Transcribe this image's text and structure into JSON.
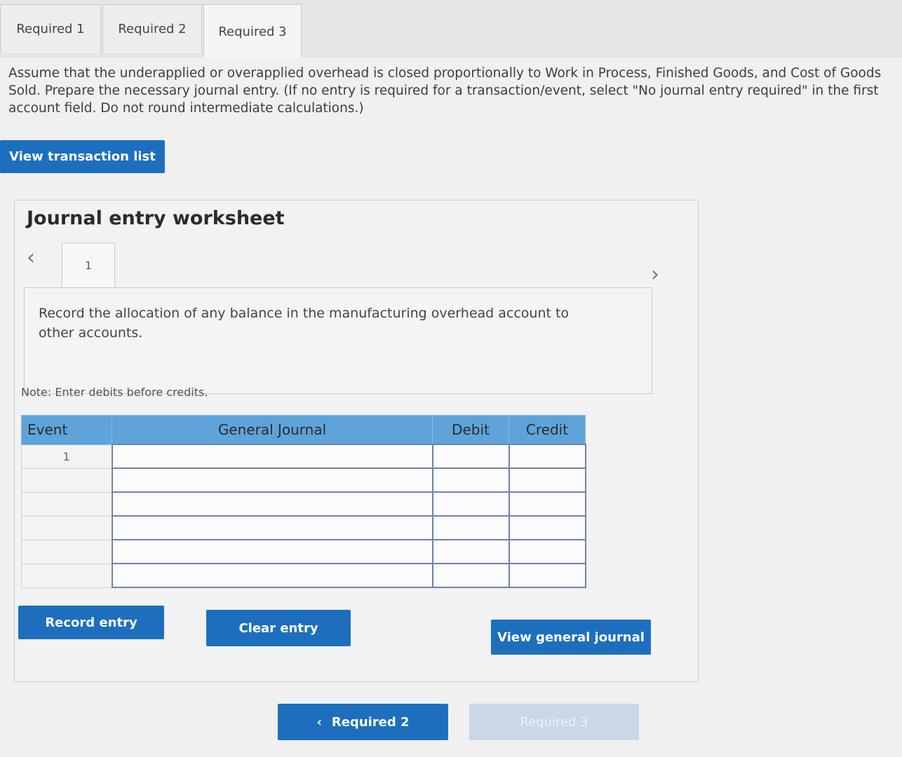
{
  "tabs": [
    {
      "label": "Required 1",
      "active": false
    },
    {
      "label": "Required 2",
      "active": false
    },
    {
      "label": "Required 3",
      "active": true
    }
  ],
  "instructions": "Assume that the underapplied or overapplied overhead is closed proportionally to Work in Process, Finished Goods, and Cost of Goods Sold. Prepare the necessary journal entry. (If no entry is required for a transaction/event, select \"No journal entry required\" in the first account field. Do not round intermediate calculations.)",
  "view_transaction_list": "View transaction list",
  "worksheet": {
    "title": "Journal entry worksheet",
    "entry_tab": "1",
    "description": "Record the allocation of any balance in the manufacturing overhead account to other accounts.",
    "note": "Note: Enter debits before credits.",
    "columns": [
      "Event",
      "General Journal",
      "Debit",
      "Credit"
    ],
    "rows": [
      {
        "event": "1",
        "account": "",
        "debit": "",
        "credit": ""
      },
      {
        "event": "",
        "account": "",
        "debit": "",
        "credit": ""
      },
      {
        "event": "",
        "account": "",
        "debit": "",
        "credit": ""
      },
      {
        "event": "",
        "account": "",
        "debit": "",
        "credit": ""
      },
      {
        "event": "",
        "account": "",
        "debit": "",
        "credit": ""
      },
      {
        "event": "",
        "account": "",
        "debit": "",
        "credit": ""
      }
    ],
    "record_entry": "Record entry",
    "clear_entry": "Clear entry",
    "view_general_journal": "View general journal"
  },
  "nav": {
    "prev_label": "Required 2",
    "next_label": "Required 3"
  },
  "colors": {
    "accent": "#1d6fbe",
    "table_header": "#5fa3db"
  }
}
